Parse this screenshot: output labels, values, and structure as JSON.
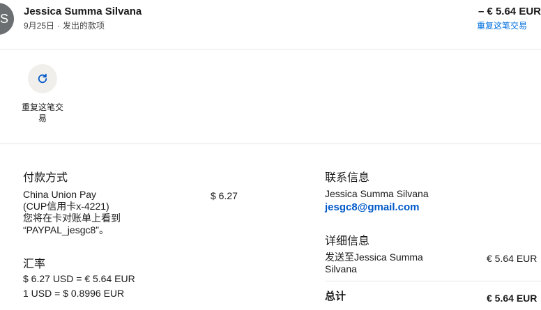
{
  "header": {
    "avatar_initial": "S",
    "name": "Jessica Summa Silvana",
    "date": "9月25日",
    "separator": "·",
    "type": "发出的款项",
    "amount": "– € 5.64 EUR",
    "repeat_link": "重复这笔交易"
  },
  "action": {
    "icon": "refresh-icon",
    "label": "重复这笔交易"
  },
  "payment": {
    "title": "付款方式",
    "method_line1": "China Union Pay",
    "method_line2": "(CUP信用卡x-4221)",
    "method_line3": "您将在卡对账单上看到",
    "method_line4": "“PAYPAL_jesgc8”。",
    "amount": "$ 6.27"
  },
  "exchange": {
    "title": "汇率",
    "line1": "$ 6.27 USD = € 5.64 EUR",
    "line2": "1 USD = $ 0.8996 EUR"
  },
  "contact": {
    "title": "联系信息",
    "name": "Jessica Summa Silvana",
    "email": "jesgc8@gmail.com"
  },
  "details": {
    "title": "详细信息",
    "sent_to_line1": "发送至Jessica Summa",
    "sent_to_line2": "Silvana",
    "sent_amount": "€ 5.64 EUR",
    "total_label": "总计",
    "total_amount": "€ 5.64 EUR"
  },
  "colors": {
    "link": "#0070e0",
    "avatar": "#6b6f72"
  }
}
